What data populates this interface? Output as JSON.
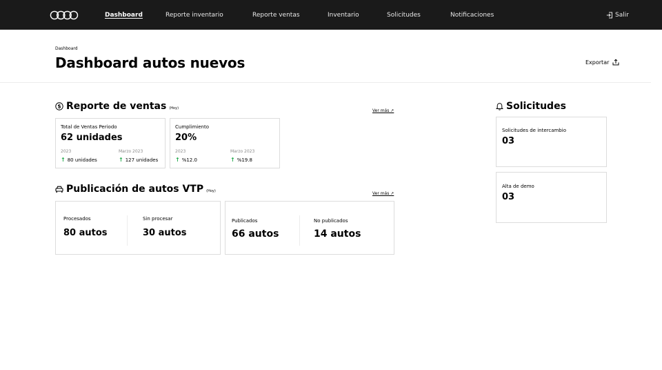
{
  "nav": {
    "items": [
      "Dashboard",
      "Reporte inventario",
      "Reporte ventas",
      "Inventario",
      "Solicitudes",
      "Notificaciones"
    ],
    "logout": "Salir"
  },
  "header": {
    "breadcrumb": "Dashboard",
    "title": "Dashboard autos nuevos",
    "export_label": "Exportar"
  },
  "sales": {
    "title": "Reporte de ventas",
    "subtitle": "(Hoy)",
    "see_more": "Ver más ↗",
    "cards": [
      {
        "label": "Total de Ventas Periodo",
        "value": "62 unidades",
        "left_label": "2023",
        "left_value": "80 unidades",
        "right_label": "Marzo 2023",
        "right_value": "127 unidades"
      },
      {
        "label": "Cumplimiento",
        "value": "20%",
        "left_label": "2023",
        "left_value": "%12.0",
        "right_label": "Marzo 2023",
        "right_value": "%19.8"
      }
    ]
  },
  "vtp": {
    "title": "Publicación de autos VTP",
    "subtitle": "(Hoy)",
    "see_more": "Ver más ↗",
    "cards": [
      {
        "left_label": "Procesados",
        "left_value": "80 autos",
        "right_label": "Sin procesar",
        "right_value": "30 autos"
      },
      {
        "left_label": "Publicados",
        "left_value": "66 autos",
        "right_label": "No publicados",
        "right_value": "14 autos"
      }
    ]
  },
  "requests": {
    "title": "Solicitudes",
    "cards": [
      {
        "label": "Solicitudes de intercambio",
        "value": "03"
      },
      {
        "label": "Alta de demo",
        "value": "03"
      }
    ]
  },
  "colors": {
    "topbar": "#1a1a1a",
    "up_arrow": "#1fa84a",
    "border": "#dcdcdc"
  }
}
